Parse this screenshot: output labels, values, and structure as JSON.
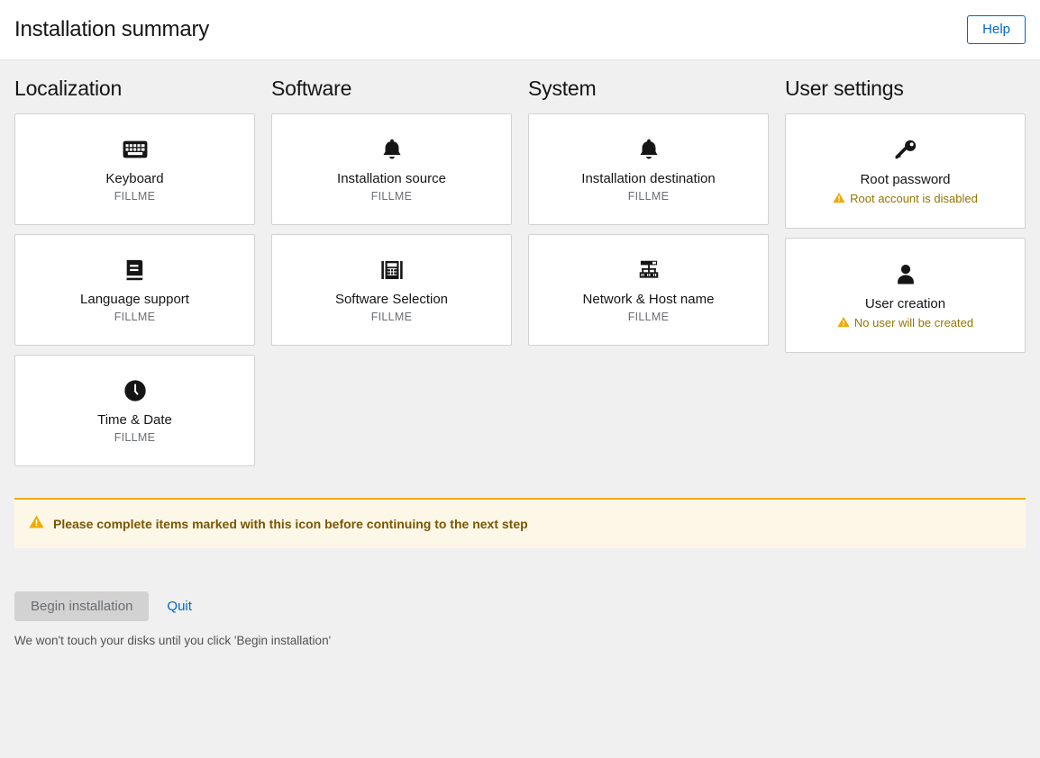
{
  "header": {
    "title": "Installation summary",
    "help_label": "Help"
  },
  "columns": [
    {
      "title": "Localization",
      "name": "localization",
      "cards": [
        {
          "name": "keyboard",
          "icon": "keyboard-icon",
          "label": "Keyboard",
          "status": "FILLME",
          "warning": null
        },
        {
          "name": "language-support",
          "icon": "book-icon",
          "label": "Language support",
          "status": "FILLME",
          "warning": null
        },
        {
          "name": "time-and-date",
          "icon": "clock-icon",
          "label": "Time & Date",
          "status": "FILLME",
          "warning": null
        }
      ]
    },
    {
      "title": "Software",
      "name": "software",
      "cards": [
        {
          "name": "installation-source",
          "icon": "bell-icon",
          "label": "Installation source",
          "status": "FILLME",
          "warning": null
        },
        {
          "name": "software-selection",
          "icon": "software-selection-icon",
          "label": "Software Selection",
          "status": "FILLME",
          "warning": null
        }
      ]
    },
    {
      "title": "System",
      "name": "system",
      "cards": [
        {
          "name": "installation-destination",
          "icon": "bell-icon",
          "label": "Installation destination",
          "status": "FILLME",
          "warning": null
        },
        {
          "name": "network-and-host-name",
          "icon": "network-icon",
          "label": "Network & Host name",
          "status": "FILLME",
          "warning": null
        }
      ]
    },
    {
      "title": "User settings",
      "name": "user-settings",
      "cards": [
        {
          "name": "root-password",
          "icon": "key-icon",
          "label": "Root password",
          "status": null,
          "warning": "Root account is disabled"
        },
        {
          "name": "user-creation",
          "icon": "user-icon",
          "label": "User creation",
          "status": null,
          "warning": "No user will be created"
        }
      ]
    }
  ],
  "alert": {
    "icon": "warning-triangle-icon",
    "text": "Please complete items marked with this icon before continuing to the next step"
  },
  "footer": {
    "begin_label": "Begin installation",
    "quit_label": "Quit",
    "note": "We won't touch your disks until you click 'Begin installation'"
  },
  "colors": {
    "background": "#f0f0f0",
    "card_border": "#d2d2d2",
    "link": "#0066cc",
    "warning_text": "#957500",
    "warning_icon": "#f0ab00",
    "alert_bg": "#fdf7e7",
    "alert_border": "#f0ab00",
    "alert_text": "#795600"
  }
}
